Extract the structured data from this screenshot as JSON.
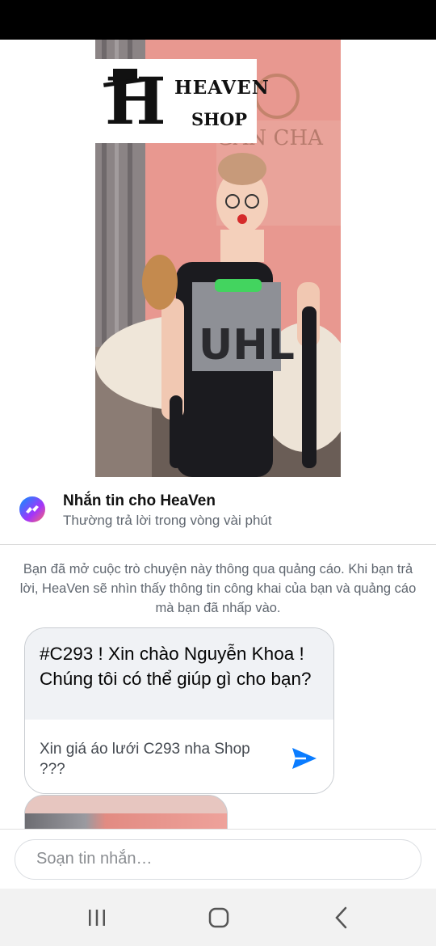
{
  "ad": {
    "logo_line1": "HEAVEN",
    "logo_line2": "SHOP"
  },
  "header": {
    "title": "Nhắn tin cho HeaVen",
    "subtitle": "Thường trả lời trong vòng vài phút",
    "icon": "messenger-icon"
  },
  "notice": "Bạn đã mở cuộc trò chuyện này thông qua quảng cáo. Khi bạn trả lời, HeaVen sẽ nhìn thấy thông tin công khai của bạn và quảng cáo mà bạn đã nhấp vào.",
  "card": {
    "message": "#C293 ! Xin chào Nguyễn Khoa ! Chúng tôi có thể giúp gì cho bạn?",
    "quick_reply": "Xin giá áo lưới C293 nha Shop ???",
    "send_icon": "send-icon"
  },
  "compose": {
    "placeholder": "Soạn tin nhắn…"
  },
  "nav": {
    "recents_icon": "recents-icon",
    "home_icon": "home-icon",
    "back_icon": "back-icon"
  },
  "colors": {
    "accent": "#0a7cff",
    "muted_text": "#606770",
    "bubble_bg": "#f0f2f5"
  }
}
